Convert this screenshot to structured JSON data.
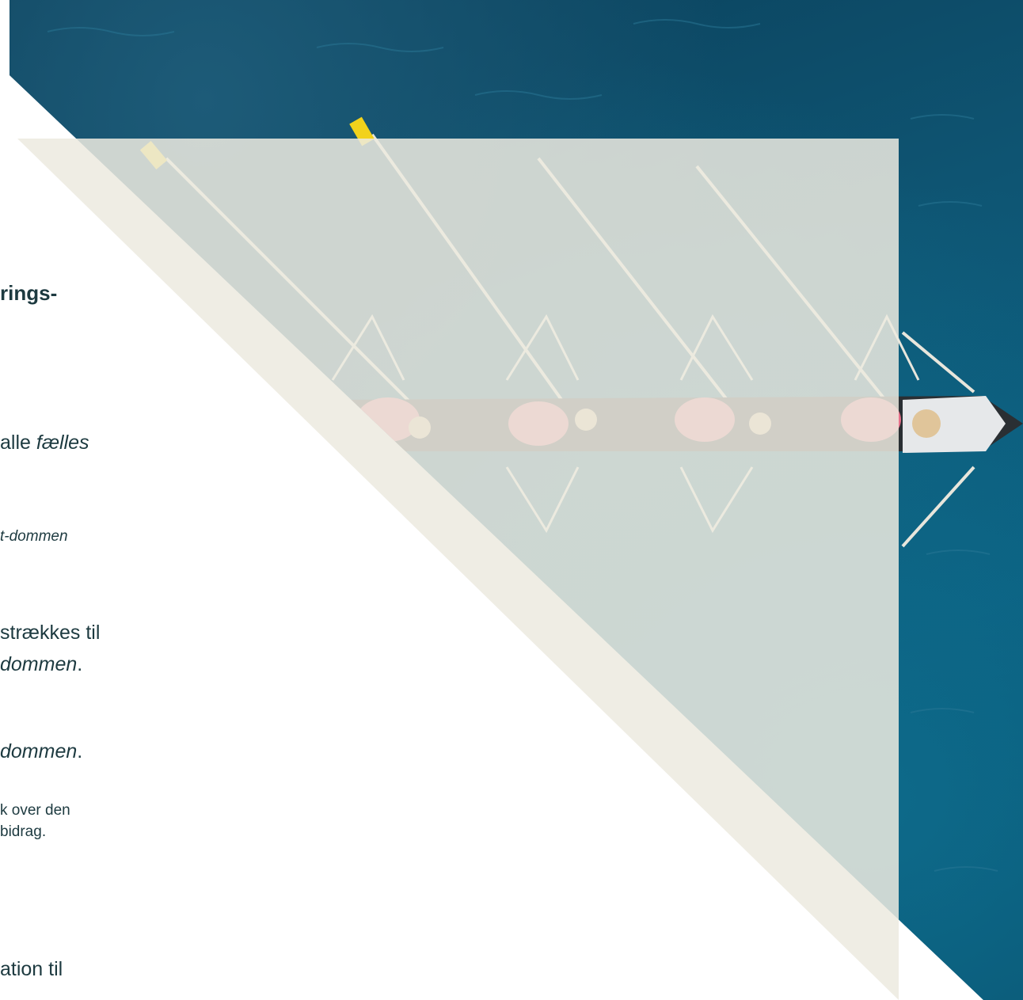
{
  "slide": {
    "heading_fragment": "rings-",
    "line1_prefix": "alle ",
    "line1_italic": "fælles",
    "line2_italic": "t-dommen",
    "line3": "strækkes til",
    "line4_italic": "dommen",
    "line4_suffix": ".",
    "line5_italic": "dommen",
    "line5_suffix": ".",
    "line6": "k over den",
    "line7": "bidrag.",
    "line8": "ation til"
  },
  "colors": {
    "text": "#1d3a40",
    "panel": "#ecEAE0",
    "water": "#0e5573",
    "blade": "#f2d21b"
  }
}
